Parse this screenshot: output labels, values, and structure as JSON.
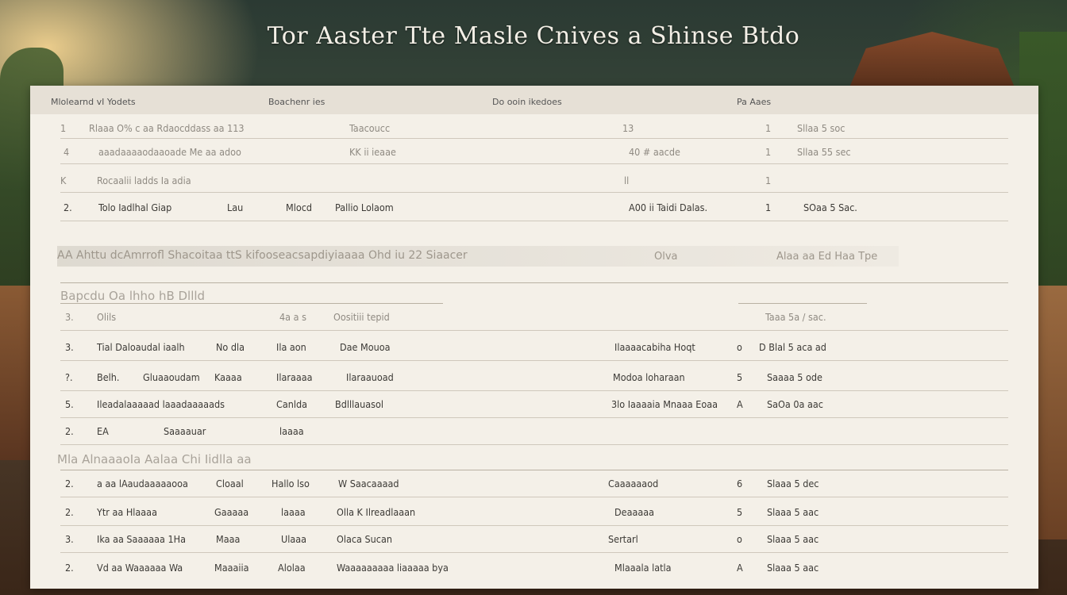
{
  "title": "Tor Aaster Tte Masle Cnives a Shinse Btdo",
  "header": {
    "col1": "Mlolearnd vI Yodets",
    "col2": "Boachenr ies",
    "col3": "Do ooin ikedoes",
    "col4": "Pa Aaes"
  },
  "group1": [
    {
      "num": "1",
      "name": "Rlaaa O% c aa Rdaocddass aa 113",
      "col2": "Taacoucc",
      "col3": "13",
      "num2": "1",
      "val": "Sllaa 5 soc"
    },
    {
      "num": "4",
      "name": "aaadaaaaodaaoade Me aa adoo",
      "col2": "KK ii ieaae",
      "col3": "40 # aacde",
      "num2": "1",
      "val": "Sllaa 55 sec"
    },
    {
      "num": "K",
      "name": "Rocaalii ladds Ia adia",
      "col2": "",
      "col3": "ll",
      "num2": "1",
      "val": ""
    },
    {
      "num": "2.",
      "name": "Tolo Iadlhal Giap",
      "col1b": "Lau",
      "col2a": "Mlocd",
      "col2": "Pallio Lolaom",
      "col3": "A00 ii Taidi Dalas.",
      "num2": "1",
      "val": "SOaa 5 Sac."
    }
  ],
  "banner": {
    "text": "AA Ahttu dcAmrrofl Shacoitaa ttS kifooseacsapdiyiaaaa Ohd iu 22 Siaacer",
    "col3": "Olva",
    "val": "Alaa aa Ed Haa Tpe"
  },
  "section1_title": "Bapcdu Oa lhho hB Dllld",
  "group2": [
    {
      "num": "3.",
      "name": "Olils",
      "col2a": "4a a s",
      "col2": "Oositiii tepid",
      "col3": "",
      "num2": "",
      "val": "Taaa 5a / sac."
    },
    {
      "num": "3.",
      "name": "Tial Daloaudal iaalh",
      "col1b": "No dla",
      "col2a": "Ila aon",
      "col2": "Dae Mouoa",
      "col3": "Ilaaaacabiha Hoqt",
      "num2": "o",
      "val": "D Blal 5 aca ad"
    },
    {
      "num": "?.",
      "name": "Belh.",
      "col1b": "Gluaaoudam",
      "col1c": "Kaaaa",
      "col2a": "Ilaraaaa",
      "col2": "Ilaraauoad",
      "col3": "Modoa loharaan",
      "num2": "5",
      "val": "Saaaa 5 ode"
    },
    {
      "num": "5.",
      "name": "Ileadalaaaaad laaadaaaaads",
      "col2a": "Canlda",
      "col2": "Bdlllauasol",
      "col3": "3lo Iaaaaia Mnaaa Eoaa",
      "num2": "A",
      "val": "SaOa 0a aac"
    },
    {
      "num": "2.",
      "name": "EA",
      "col1b": "Saaaauar",
      "col2a": "laaaa",
      "col2": "",
      "col3": "",
      "num2": "",
      "val": ""
    }
  ],
  "section2_title": "Mla AlnaaaoIa Aalaa Chi Iidlla aa",
  "group3": [
    {
      "num": "2.",
      "name": "a aa lAaudaaaaaooa",
      "col1b": "Cloaal",
      "col2a": "Hallo lso",
      "col2": "W Saacaaaad",
      "col3": "Caaaaaaod",
      "num2": "6",
      "val": "Slaaa 5 dec"
    },
    {
      "num": "2.",
      "name": "Ytr aa Hlaaaa",
      "col1b": "Gaaaaa",
      "col2a": "laaaa",
      "col2": "Olla K Ilreadlaaan",
      "col3": "Deaaaaa",
      "num2": "5",
      "val": "Slaaa 5 aac"
    },
    {
      "num": "3.",
      "name": "Ika aa Saaaaaa 1Ha",
      "col1b": "Maaa",
      "col2a": "Ulaaa",
      "col2": "Olaca Sucan",
      "col3": "Sertarl",
      "num2": "o",
      "val": "Slaaa 5 aac"
    },
    {
      "num": "2.",
      "name": "Vd aa Waaaaaa Wa",
      "col1b": "Maaaiia",
      "col2a": "Alolaa",
      "col2": "Waaaaaaaaa liaaaaa bya",
      "col3": "Mlaaala latla",
      "num2": "A",
      "val": "Slaaa 5 aac"
    }
  ]
}
